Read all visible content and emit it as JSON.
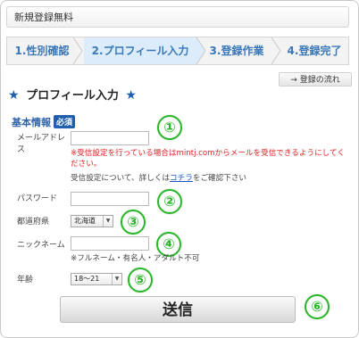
{
  "title_bar": {
    "text": "新規登録無料"
  },
  "steps": [
    {
      "label": "1.性別確認"
    },
    {
      "label": "2.プロフィール入力"
    },
    {
      "label": "3.登録作業"
    },
    {
      "label": "4.登録完了"
    }
  ],
  "flow_link": {
    "label": "→ 登録の流れ"
  },
  "page_title": {
    "text": "プロフィール入力"
  },
  "section": {
    "label": "基本情報",
    "required_badge": "必須"
  },
  "fields": {
    "email": {
      "label_line1": "メールアドレ",
      "label_line2": "ス",
      "value": ""
    },
    "email_warning": "※受信設定を行っている場合はmintj.comからメールを受信できるようにしてください。",
    "email_info_prefix": "受信設定について、詳しくは",
    "email_info_link": "コチラ",
    "email_info_suffix": "をご確認下さい",
    "password": {
      "label": "パスワード",
      "value": ""
    },
    "prefecture": {
      "label": "都道府県",
      "selected": "北海道"
    },
    "nickname": {
      "label": "ニックネーム",
      "value": "",
      "note": "※フルネーム・有名人・アダルト不可"
    },
    "age": {
      "label": "年齢",
      "selected": "18～21"
    }
  },
  "submit": {
    "label": "送信"
  },
  "markers": [
    "①",
    "②",
    "③",
    "④",
    "⑤",
    "⑥"
  ],
  "colors": {
    "accent_blue": "#1f5fae",
    "marker_green": "#2bb52b",
    "warning_red": "#e02020"
  }
}
